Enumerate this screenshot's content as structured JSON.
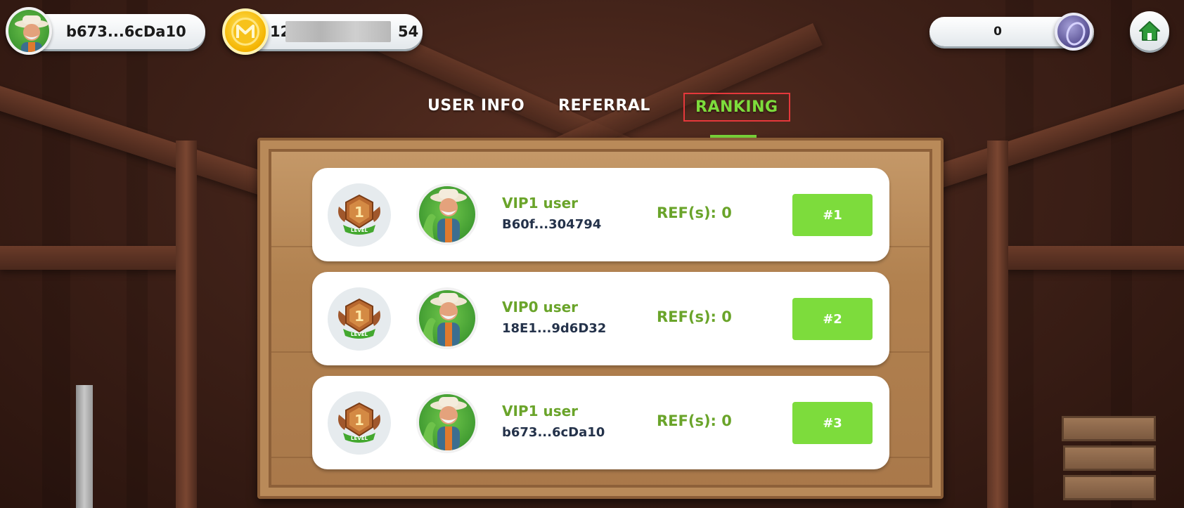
{
  "header": {
    "wallet_address": "b673...6cDa10",
    "token_balance_visible_prefix": "12",
    "token_balance_visible_suffix": "54",
    "energy_value": "0"
  },
  "tabs": [
    {
      "label": "USER INFO",
      "active": false
    },
    {
      "label": "REFERRAL",
      "active": false
    },
    {
      "label": "RANKING",
      "active": true
    }
  ],
  "ranking": [
    {
      "vip": "VIP1 user",
      "address": "B60f...304794",
      "refs": "REF(s): 0",
      "rank": "#1",
      "level": "1",
      "level_label": "LEVEL"
    },
    {
      "vip": "VIP0 user",
      "address": "18E1...9d6D32",
      "refs": "REF(s): 0",
      "rank": "#2",
      "level": "1",
      "level_label": "LEVEL"
    },
    {
      "vip": "VIP1 user",
      "address": "b673...6cDa10",
      "refs": "REF(s): 0",
      "rank": "#3",
      "level": "1",
      "level_label": "LEVEL"
    }
  ],
  "colors": {
    "accent_green": "#7ddc3c",
    "text_green": "#6aa42a",
    "address_navy": "#24324a",
    "active_tab_outline": "#e5383b",
    "board_wood": "#b1814f"
  },
  "icons": {
    "home": "home-icon",
    "coin": "token-coin-icon",
    "energy": "energy-token-icon",
    "badge": "level-badge-icon",
    "avatar": "farmer-avatar"
  }
}
